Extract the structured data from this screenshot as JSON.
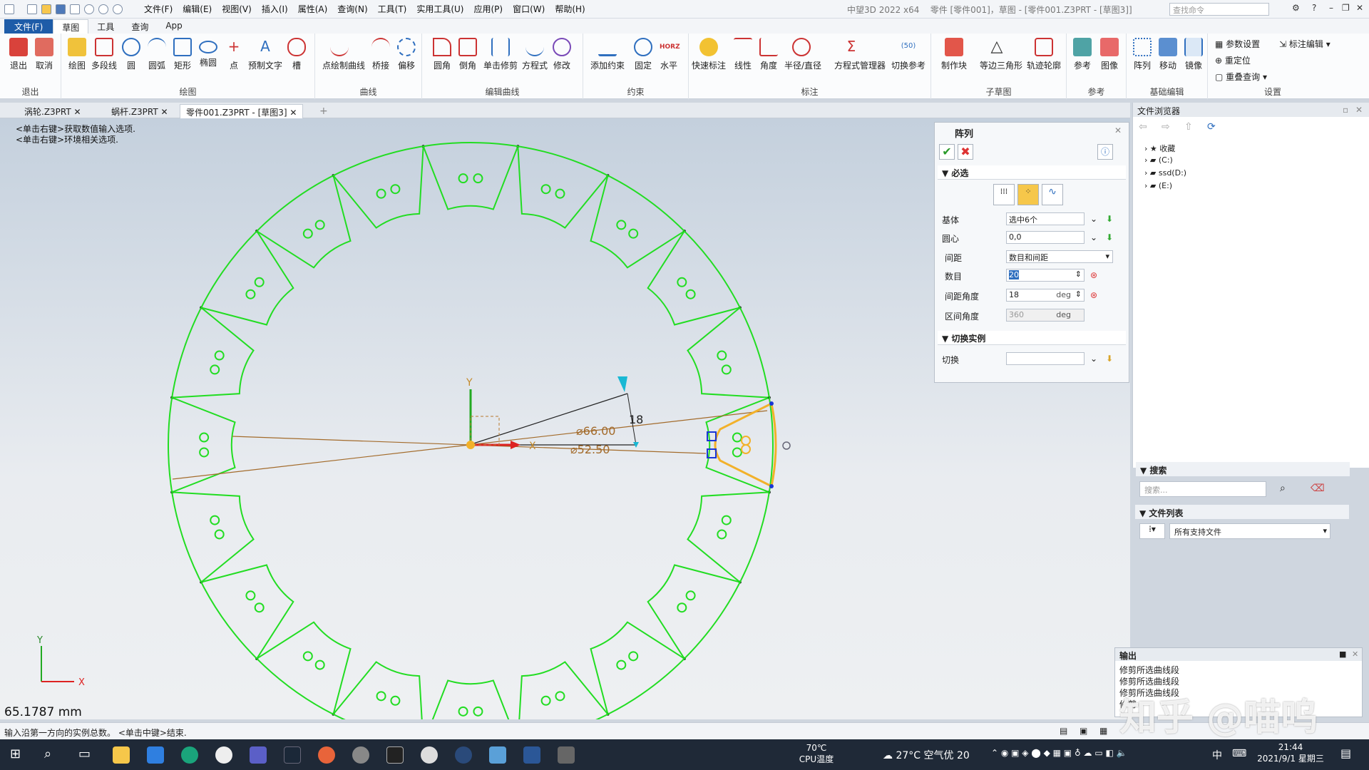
{
  "titlebar": {
    "menus": [
      "文件(F)",
      "编辑(E)",
      "视图(V)",
      "插入(I)",
      "属性(A)",
      "查询(N)",
      "工具(T)",
      "实用工具(U)",
      "应用(P)",
      "窗口(W)",
      "帮助(H)"
    ],
    "app_title": "中望3D 2022 x64",
    "doc_title": "零件 [零件001]，草图 - [零件001.Z3PRT - [草图3]]",
    "search_placeholder": "查找命令"
  },
  "ribbon_tabs": [
    "文件(F)",
    "草图",
    "工具",
    "查询",
    "App"
  ],
  "ribbon": {
    "g_exit": {
      "label": "退出",
      "buttons": [
        "退出",
        "取消"
      ]
    },
    "g_draw": {
      "label": "绘图",
      "buttons": [
        "绘图",
        "多段线",
        "圆",
        "圆弧",
        "矩形",
        "椭圆",
        "点",
        "预制文字",
        "槽"
      ]
    },
    "g_curve": {
      "label": "曲线",
      "buttons": [
        "点绘制曲线",
        "桥接",
        "偏移"
      ]
    },
    "g_edit": {
      "label": "编辑曲线",
      "buttons": [
        "圆角",
        "倒角",
        "单击修剪",
        "方程式",
        "修改"
      ]
    },
    "g_constraint": {
      "label": "约束",
      "buttons": [
        "添加约束",
        "固定",
        "水平"
      ]
    },
    "g_dim": {
      "label": "标注",
      "buttons": [
        "快速标注",
        "线性",
        "角度",
        "半径/直径",
        "方程式管理器",
        "切换参考"
      ]
    },
    "g_sub": {
      "label": "子草图",
      "buttons": [
        "制作块",
        "等边三角形",
        "轨迹轮廓"
      ]
    },
    "g_ref": {
      "label": "参考",
      "buttons": [
        "参考",
        "图像"
      ]
    },
    "g_basic": {
      "label": "基础编辑",
      "buttons": [
        "阵列",
        "移动",
        "镜像"
      ]
    },
    "g_settings": {
      "label": "设置",
      "buttons": [
        "参数设置",
        "重定位",
        "重叠查询",
        "标注编辑"
      ]
    }
  },
  "doc_tabs": [
    {
      "label": "涡轮.Z3PRT"
    },
    {
      "label": "蜗杆.Z3PRT"
    },
    {
      "label": "零件001.Z3PRT - [草图3]"
    }
  ],
  "canvas": {
    "hints": [
      "<单击右键>获取数值输入选项.",
      "<单击右键>环境相关选项."
    ],
    "dims": {
      "d1": "⌀66.00",
      "d2": "⌀52.50",
      "angle": "18"
    },
    "axis_x": "X",
    "axis_y": "Y",
    "measure": "65.1787 mm"
  },
  "array_panel": {
    "title": "阵列",
    "sec_required": "必选",
    "base_label": "基体",
    "base_value": "选中6个",
    "center_label": "圆心",
    "center_value": "0,0",
    "spacing_label": "间距",
    "spacing_value": "数目和间距",
    "count_label": "数目",
    "count_value": "20",
    "angle_label": "间距角度",
    "angle_value": "18",
    "angle_unit": "deg",
    "range_label": "区间角度",
    "range_value": "360",
    "range_unit": "deg",
    "sec_switch": "切换实例",
    "switch_label": "切换",
    "ok": "✔",
    "cancel": "✖"
  },
  "browser": {
    "title": "文件浏览器",
    "tree": [
      "收藏",
      "(C:)",
      "ssd(D:)",
      "(E:)"
    ],
    "search_title": "搜索",
    "search_placeholder": "搜索...",
    "list_title": "文件列表",
    "filter": "所有支持文件"
  },
  "output": {
    "title": "输出",
    "lines": [
      "修剪所选曲线段",
      "修剪所选曲线段",
      "修剪所选曲线段",
      "修剪"
    ]
  },
  "status": {
    "text": "输入沿第一方向的实例总数。 <单击中键>结束."
  },
  "taskbar": {
    "cpu_temp": "70℃",
    "cpu_label": "CPU温度",
    "weather": "27°C 空气优 20",
    "ime": "中",
    "time": "21:44",
    "date": "2021/9/1 星期三"
  },
  "watermark": "知乎 @喵呜",
  "colors": {
    "sketch": "#22dd22",
    "accent": "#1e5ca8",
    "selected": "#f2b12a"
  }
}
